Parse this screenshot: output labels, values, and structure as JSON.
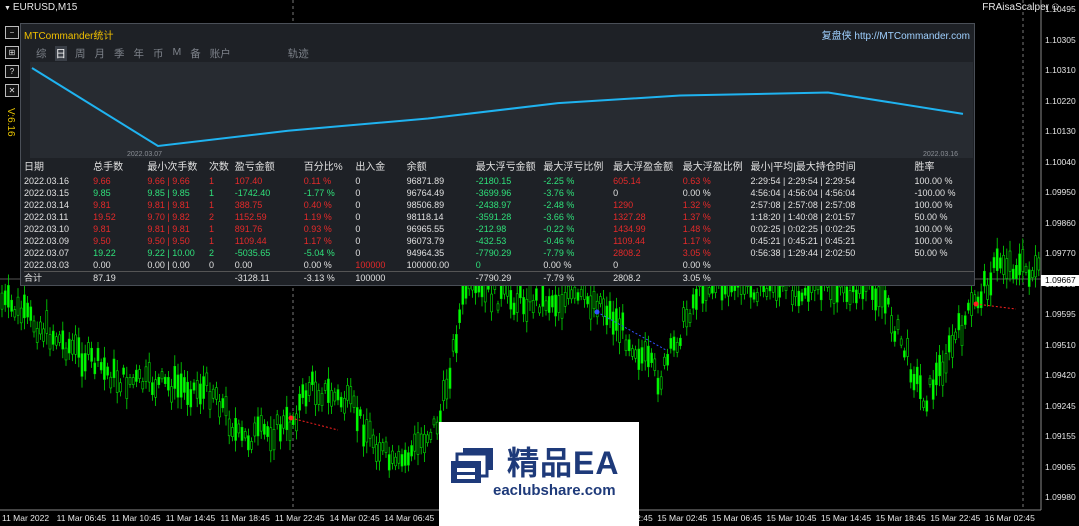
{
  "chart": {
    "symbol": "EURUSD,M15",
    "ea_name": "FRAisaScalper",
    "price_ticks": [
      "1.10495",
      "1.10305",
      "1.10310",
      "1.10220",
      "1.10130",
      "1.10040",
      "1.09950",
      "1.09860",
      "1.09770",
      "1.09685",
      "1.09595",
      "1.09510",
      "1.09420",
      "1.09245",
      "1.09155",
      "1.09065",
      "1.09980"
    ],
    "current_price": "1.09667",
    "time_ticks": [
      "11 Mar 2022",
      "11 Mar 06:45",
      "11 Mar 10:45",
      "11 Mar 14:45",
      "11 Mar 18:45",
      "11 Mar 22:45",
      "14 Mar 02:45",
      "14 Mar 06:45",
      "14 Mar 10:45",
      "14 Mar 14:45",
      "14 Mar 18:45",
      "14 Mar 22:45",
      "15 Mar 02:45",
      "15 Mar 06:45",
      "15 Mar 10:45",
      "15 Mar 14:45",
      "15 Mar 18:45",
      "15 Mar 22:45",
      "16 Mar 02:45"
    ],
    "colors": {
      "bull": "#00ff00",
      "bear": "#00ff00",
      "background": "#000000"
    }
  },
  "side_buttons": [
    "−",
    "⊞",
    "?",
    "✕"
  ],
  "version": "V:6.16",
  "panel": {
    "title": "MTCommander统计",
    "site_cn": "复盘侠",
    "site_url": "http://MTCommander.com",
    "tabs": [
      "综",
      "日",
      "周",
      "月",
      "季",
      "年",
      "币",
      "M",
      "备",
      "账户",
      "轨迹"
    ],
    "active_tab": "日",
    "date_start": "2022.03.07",
    "date_end": "2022.03.16",
    "headers": [
      "日期",
      "总手数",
      "最小次手数",
      "次数",
      "盈亏金额",
      "百分比%",
      "出入金",
      "余额",
      "最大浮亏金额",
      "最大浮亏比例",
      "最大浮盈金额",
      "最大浮盈比例",
      "最小|平均|最大持仓时间",
      "胜率"
    ],
    "rows": [
      [
        "2022.03.16",
        "9.66",
        "9.66 | 9.66",
        "1",
        "107.40",
        "0.11 %",
        "0",
        "96871.89",
        "-2180.15",
        "-2.25 %",
        "605.14",
        "0.63 %",
        "2:29:54 | 2:29:54 | 2:29:54",
        "100.00 %"
      ],
      [
        "2022.03.15",
        "9.85",
        "9.85 | 9.85",
        "1",
        "-1742.40",
        "-1.77 %",
        "0",
        "96764.49",
        "-3699.96",
        "-3.76 %",
        "0",
        "0.00 %",
        "4:56:04 | 4:56:04 | 4:56:04",
        "-100.00 %"
      ],
      [
        "2022.03.14",
        "9.81",
        "9.81 | 9.81",
        "1",
        "388.75",
        "0.40 %",
        "0",
        "98506.89",
        "-2438.97",
        "-2.48 %",
        "1290",
        "1.32 %",
        "2:57:08 | 2:57:08 | 2:57:08",
        "100.00 %"
      ],
      [
        "2022.03.11",
        "19.52",
        "9.70 | 9.82",
        "2",
        "1152.59",
        "1.19 %",
        "0",
        "98118.14",
        "-3591.28",
        "-3.66 %",
        "1327.28",
        "1.37 %",
        "1:18:20 | 1:40:08 | 2:01:57",
        "50.00 %"
      ],
      [
        "2022.03.10",
        "9.81",
        "9.81 | 9.81",
        "1",
        "891.76",
        "0.93 %",
        "0",
        "96965.55",
        "-212.98",
        "-0.22 %",
        "1434.99",
        "1.48 %",
        "0:02:25 | 0:02:25 | 0:02:25",
        "100.00 %"
      ],
      [
        "2022.03.09",
        "9.50",
        "9.50 | 9.50",
        "1",
        "1109.44",
        "1.17 %",
        "0",
        "96073.79",
        "-432.53",
        "-0.46 %",
        "1109.44",
        "1.17 %",
        "0:45:21 | 0:45:21 | 0:45:21",
        "100.00 %"
      ],
      [
        "2022.03.07",
        "19.22",
        "9.22 | 10.00",
        "2",
        "-5035.65",
        "-5.04 %",
        "0",
        "94964.35",
        "-7790.29",
        "-7.79 %",
        "2808.2",
        "3.05 %",
        "0:56:38 | 1:29:44 | 2:02:50",
        "50.00 %"
      ],
      [
        "2022.03.03",
        "0.00",
        "0.00 | 0.00",
        "0",
        "0.00",
        "0.00 %",
        "100000",
        "100000.00",
        "0",
        "0.00 %",
        "0",
        "0.00 %",
        "",
        ""
      ]
    ],
    "row_colors": [
      [
        "w",
        "r",
        "r",
        "r",
        "r",
        "r",
        "w",
        "w",
        "g",
        "g",
        "r",
        "r",
        "w",
        "w"
      ],
      [
        "w",
        "g",
        "g",
        "g",
        "g",
        "g",
        "w",
        "w",
        "g",
        "g",
        "w",
        "w",
        "w",
        "w"
      ],
      [
        "w",
        "r",
        "r",
        "r",
        "r",
        "r",
        "w",
        "w",
        "g",
        "g",
        "r",
        "r",
        "w",
        "w"
      ],
      [
        "w",
        "r",
        "r",
        "r",
        "r",
        "r",
        "w",
        "w",
        "g",
        "g",
        "r",
        "r",
        "w",
        "w"
      ],
      [
        "w",
        "r",
        "r",
        "r",
        "r",
        "r",
        "w",
        "w",
        "g",
        "g",
        "r",
        "r",
        "w",
        "w"
      ],
      [
        "w",
        "r",
        "r",
        "r",
        "r",
        "r",
        "w",
        "w",
        "g",
        "g",
        "r",
        "r",
        "w",
        "w"
      ],
      [
        "w",
        "g",
        "g",
        "g",
        "g",
        "g",
        "w",
        "w",
        "g",
        "g",
        "r",
        "r",
        "w",
        "w"
      ],
      [
        "w",
        "w",
        "w",
        "w",
        "w",
        "w",
        "r",
        "w",
        "g",
        "w",
        "w",
        "w",
        "w",
        "w"
      ]
    ],
    "total": {
      "label": "合计",
      "lots": "87.19",
      "pnl": "-3128.11",
      "pct": "-3.13 %",
      "deposit": "100000",
      "max_loss": "-7790.29",
      "max_loss_pct": "-7.79 %",
      "max_profit": "2808.2",
      "max_profit_pct": "3.05 %"
    },
    "equity_series": [
      {
        "date": "2022.03.07",
        "balance": 103200
      },
      {
        "date": "2022.03.08",
        "balance": 100650
      },
      {
        "date": "2022.03.09",
        "balance": 101150
      },
      {
        "date": "2022.03.10",
        "balance": 101550
      },
      {
        "date": "2022.03.11",
        "balance": 102050
      },
      {
        "date": "2022.03.14",
        "balance": 102300
      },
      {
        "date": "2022.03.14b",
        "balance": 102400
      },
      {
        "date": "2022.03.15",
        "balance": 101700
      },
      {
        "date": "2022.03.16",
        "balance": 101700
      }
    ]
  },
  "watermark": {
    "title": "精品EA",
    "url": "eaclubshare.com"
  }
}
